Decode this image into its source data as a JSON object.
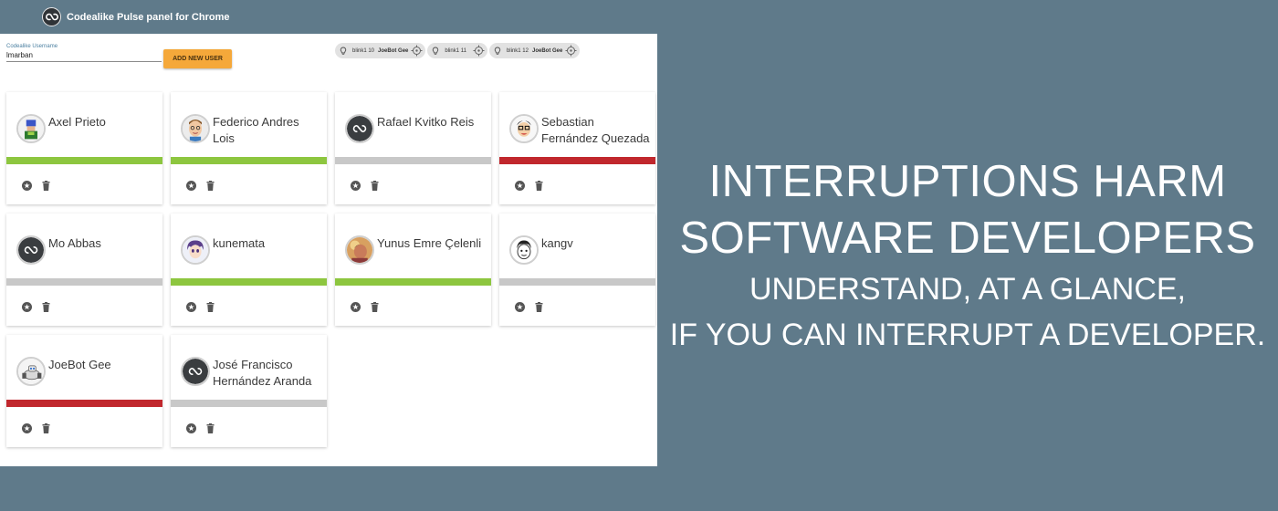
{
  "app": {
    "title": "Codealike Pulse panel for Chrome",
    "logo": "codealike-logo-icon"
  },
  "form": {
    "username_label": "Codealike Username",
    "username_value": "lmarban",
    "add_button": "ADD NEW USER"
  },
  "devices": [
    {
      "name": "blink1 10",
      "user": "JoeBot Gee"
    },
    {
      "name": "blink1 11",
      "user": ""
    },
    {
      "name": "blink1 12",
      "user": "JoeBot Gee"
    }
  ],
  "status_colors": {
    "available": "#8dc63f",
    "busy": "#c1272d",
    "offline": "#c8c8c8"
  },
  "users": [
    {
      "name": "Axel Prieto",
      "status": "available",
      "avatar": "pixel-avatar"
    },
    {
      "name": "Federico Andres Lois",
      "status": "available",
      "avatar": "face-avatar"
    },
    {
      "name": "Rafael Kvitko Reis",
      "status": "offline",
      "avatar": "codealike-default-avatar"
    },
    {
      "name": "Sebastian Fernández Quezada",
      "status": "busy",
      "avatar": "cartoon-avatar"
    },
    {
      "name": "Mo Abbas",
      "status": "offline",
      "avatar": "codealike-default-avatar"
    },
    {
      "name": "kunemata",
      "status": "available",
      "avatar": "anime-avatar"
    },
    {
      "name": "Yunus Emre Çelenli",
      "status": "available",
      "avatar": "photo-avatar"
    },
    {
      "name": "kangv",
      "status": "offline",
      "avatar": "sketch-avatar"
    },
    {
      "name": "JoeBot Gee",
      "status": "busy",
      "avatar": "robot-avatar"
    },
    {
      "name": "José Francisco Hernández Aranda",
      "status": "offline",
      "avatar": "codealike-default-avatar"
    }
  ],
  "headline": {
    "line1": "INTERRUPTIONS HARM",
    "line2": "SOFTWARE DEVELOPERS",
    "line3": "UNDERSTAND, AT A GLANCE,",
    "line4": "IF YOU CAN INTERRUPT A DEVELOPER."
  }
}
